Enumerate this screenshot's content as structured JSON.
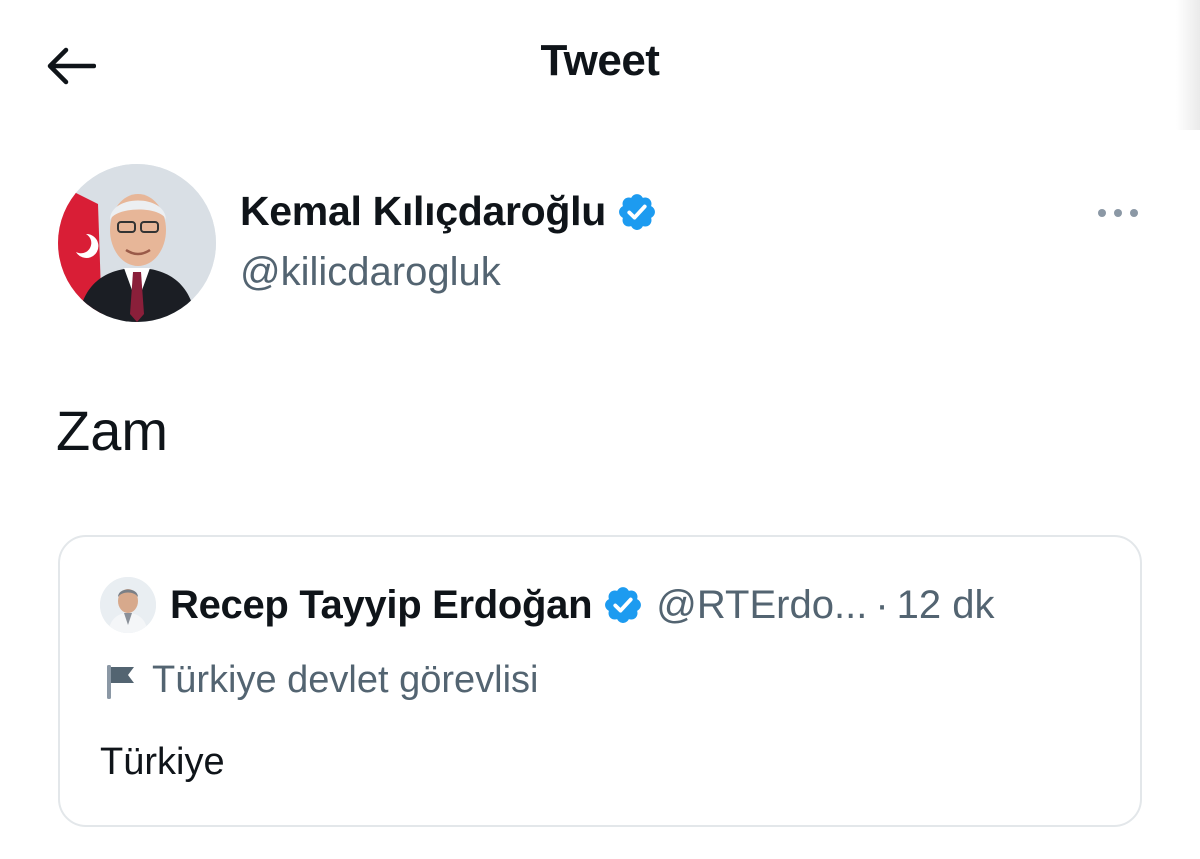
{
  "header": {
    "title": "Tweet",
    "back_icon": "arrow-left-icon"
  },
  "tweet": {
    "author": {
      "name": "Kemal Kılıçdaroğlu",
      "handle": "@kilicdarogluk",
      "verified_icon": "verified-badge-icon"
    },
    "more_icon": "more-horizontal-icon",
    "text": "Zam"
  },
  "quoted_tweet": {
    "author": {
      "name": "Recep Tayyip Erdoğan",
      "handle": "@RTErdo...",
      "verified_icon": "verified-badge-icon"
    },
    "separator": "·",
    "time": "12 dk",
    "label_icon": "flag-icon",
    "label": "Türkiye devlet görevlisi",
    "text": "Türkiye"
  },
  "colors": {
    "verified": "#1d9bf0",
    "secondary_text": "#536471",
    "primary_text": "#0f1419",
    "border": "#e3e7ea"
  }
}
